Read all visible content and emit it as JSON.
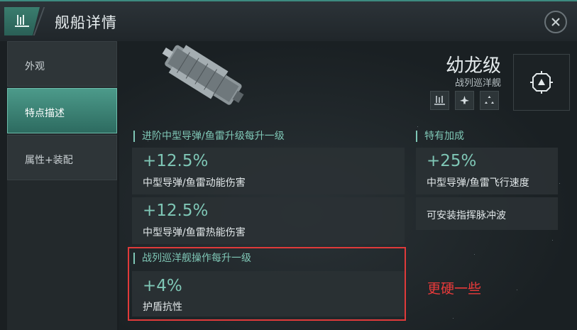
{
  "header": {
    "title": "舰船详情",
    "icon": "fleet-icon",
    "close_icon": "close-icon"
  },
  "sidebar": {
    "items": [
      {
        "label": "外观",
        "active": false
      },
      {
        "label": "特点描述",
        "active": true
      },
      {
        "label": "属性+装配",
        "active": false
      }
    ]
  },
  "ship": {
    "name": "幼龙级",
    "class": "战列巡洋舰",
    "role_icons": [
      "fleet-icon",
      "fighter-icon",
      "triangle-formation-icon"
    ],
    "big_icon": "target-frame-icon"
  },
  "sections": {
    "left_top": {
      "title": "进阶中型导弹/鱼雷升级每升一级",
      "bonuses": [
        {
          "value": "+12.5%",
          "desc": "中型导弹/鱼雷动能伤害"
        },
        {
          "value": "+12.5%",
          "desc": "中型导弹/鱼雷热能伤害"
        }
      ]
    },
    "left_bottom": {
      "title": "战列巡洋舰操作每升一级",
      "bonuses": [
        {
          "value": "+4%",
          "desc": "护盾抗性"
        }
      ]
    },
    "right": {
      "title": "特有加成",
      "bonuses": [
        {
          "value": "+25%",
          "desc": "中型导弹/鱼雷飞行速度"
        },
        {
          "value": "",
          "desc": "可安装指挥脉冲波"
        }
      ]
    }
  },
  "annotation": {
    "text": "更硬一些",
    "color": "#e83a3a"
  },
  "colors": {
    "accent": "#7fc7b6",
    "active_tab": "#3d8a7b",
    "highlight": "#e03a3a"
  }
}
